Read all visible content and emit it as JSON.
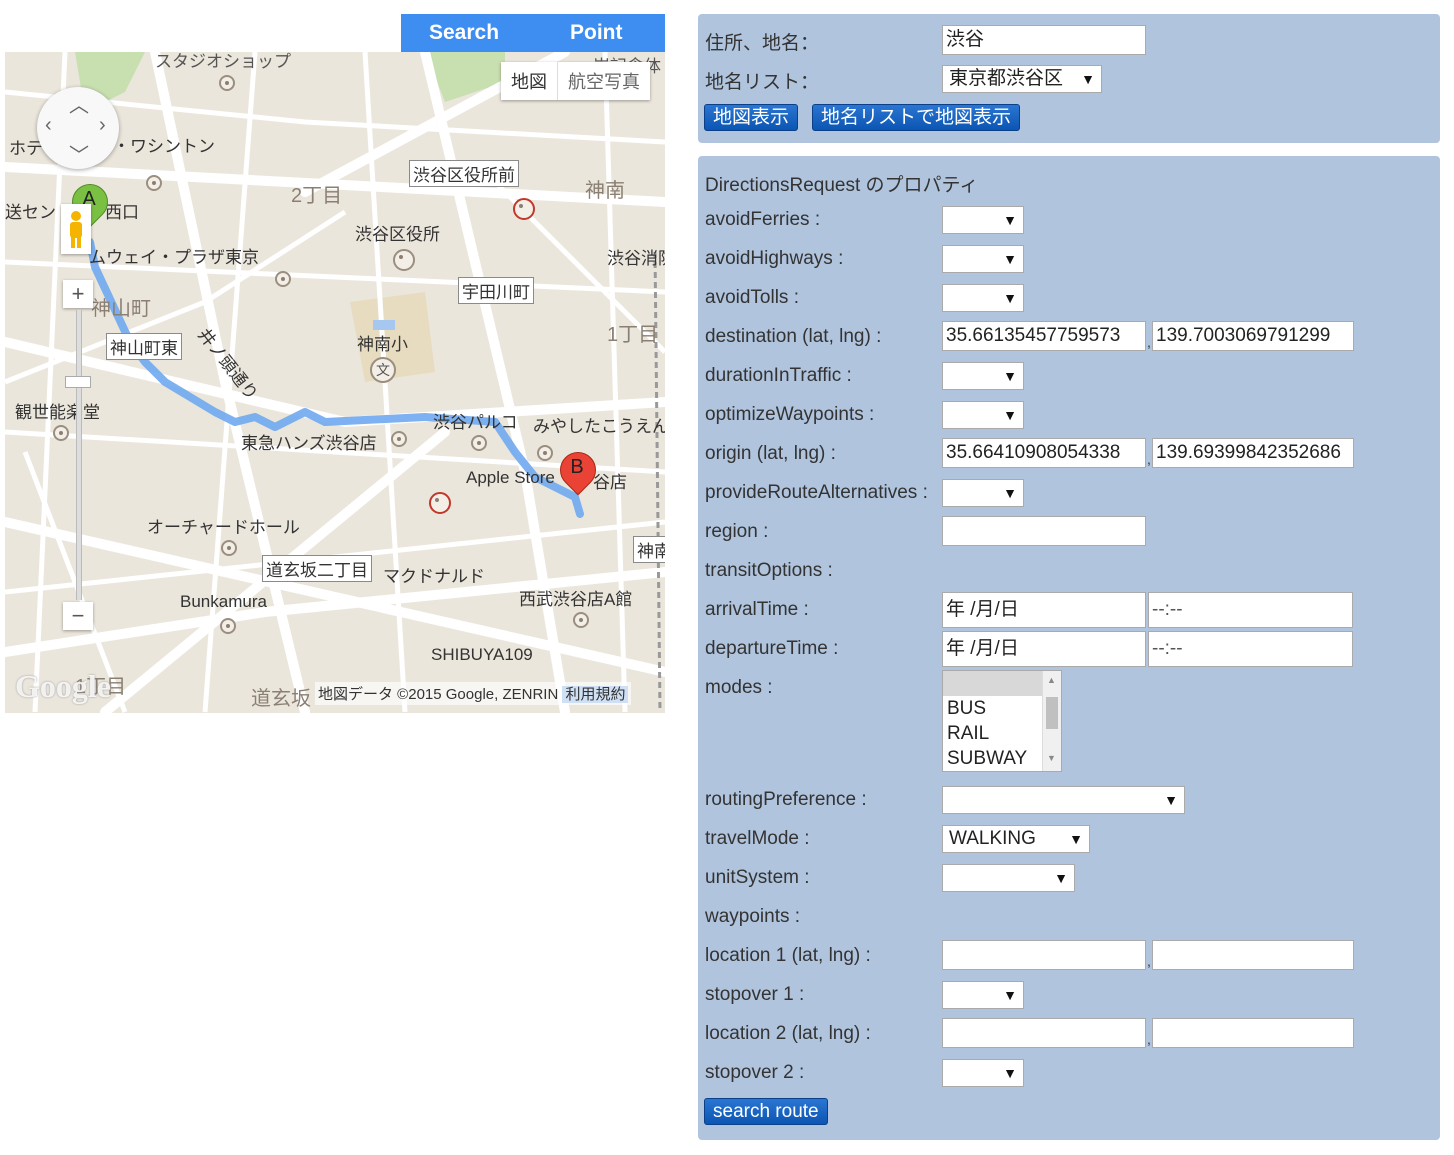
{
  "header": {
    "tab_search": "Search",
    "tab_point": "Point"
  },
  "map": {
    "map_type": {
      "map": "地図",
      "satellite": "航空写真"
    },
    "labels": {
      "l1": "スタジオショップ",
      "l2": "岸記念体",
      "l3": "ホテ",
      "l4": "・ワシントン",
      "l5": "2丁目",
      "l6": "渋谷区役所前",
      "l7": "神南",
      "l8": "送セン",
      "l9": "西口",
      "l10": "渋谷区役所",
      "l11": "渋谷消防",
      "l12": "ムウェイ・プラザ東京",
      "l13": "宇田川町",
      "l14": "神山町",
      "l15": "井ノ頭通り",
      "l16": "1丁目",
      "l17": "神山町東",
      "l18": "神南小",
      "l19": "観世能楽堂",
      "l20": "渋谷パルコ",
      "l21": "みやしたこうえん",
      "l22": "東急ハンズ渋谷店",
      "l23": "Apple Store",
      "l24": "谷店",
      "l25": "オーチャードホール",
      "l26": "神南",
      "l27": "道玄坂二丁目",
      "l28": "マクドナルド",
      "l29": "西武渋谷店A館",
      "l30": "Bunkamura",
      "l31": "SHIBUYA109",
      "l32": "1丁目",
      "l33": "道玄坂",
      "school": "文"
    },
    "marker_a": "A",
    "marker_b": "B",
    "logo": "Google",
    "attribution": "地図データ ©2015 Google, ZENRIN",
    "terms": "利用規約",
    "zoom_in": "+",
    "zoom_out": "−"
  },
  "search_panel": {
    "address_label": "住所、地名：",
    "address_value": "渋谷",
    "list_label": "地名リスト：",
    "list_value": "東京都渋谷区",
    "btn_show": "地図表示",
    "btn_show_list": "地名リストで地図表示"
  },
  "directions": {
    "title": "DirectionsRequest のプロパティ",
    "avoidFerries": "avoidFerries :",
    "avoidHighways": "avoidHighways :",
    "avoidTolls": "avoidTolls :",
    "destination": "destination (lat, lng) :",
    "destination_lat": "35.66135457759573",
    "destination_lng": "139.7003069791299",
    "durationInTraffic": "durationInTraffic :",
    "optimizeWaypoints": "optimizeWaypoints :",
    "origin": "origin (lat, lng) :",
    "origin_lat": "35.66410908054338",
    "origin_lng": "139.69399842352686",
    "provideRouteAlternatives": "provideRouteAlternatives :",
    "region": "region :",
    "transitOptions": "transitOptions :",
    "arrivalTime": "arrivalTime :",
    "departureTime": "departureTime :",
    "date_placeholder": " 年 /月/日",
    "time_placeholder": "--:--",
    "modes": "modes :",
    "modes_options": [
      "BUS",
      "RAIL",
      "SUBWAY"
    ],
    "routingPreference": "routingPreference :",
    "travelMode": "travelMode :",
    "travelMode_value": "WALKING",
    "unitSystem": "unitSystem :",
    "waypoints": "waypoints :",
    "location1": "location 1 (lat, lng) :",
    "stopover1": "stopover 1 :",
    "location2": "location 2 (lat, lng) :",
    "stopover2": "stopover 2 :",
    "comma": ",",
    "search_button": "search route"
  },
  "colors": {
    "panel": "#b0c4de",
    "tab": "#3d8ef0",
    "button": "#1464c4",
    "route": "#6fa8f0"
  }
}
